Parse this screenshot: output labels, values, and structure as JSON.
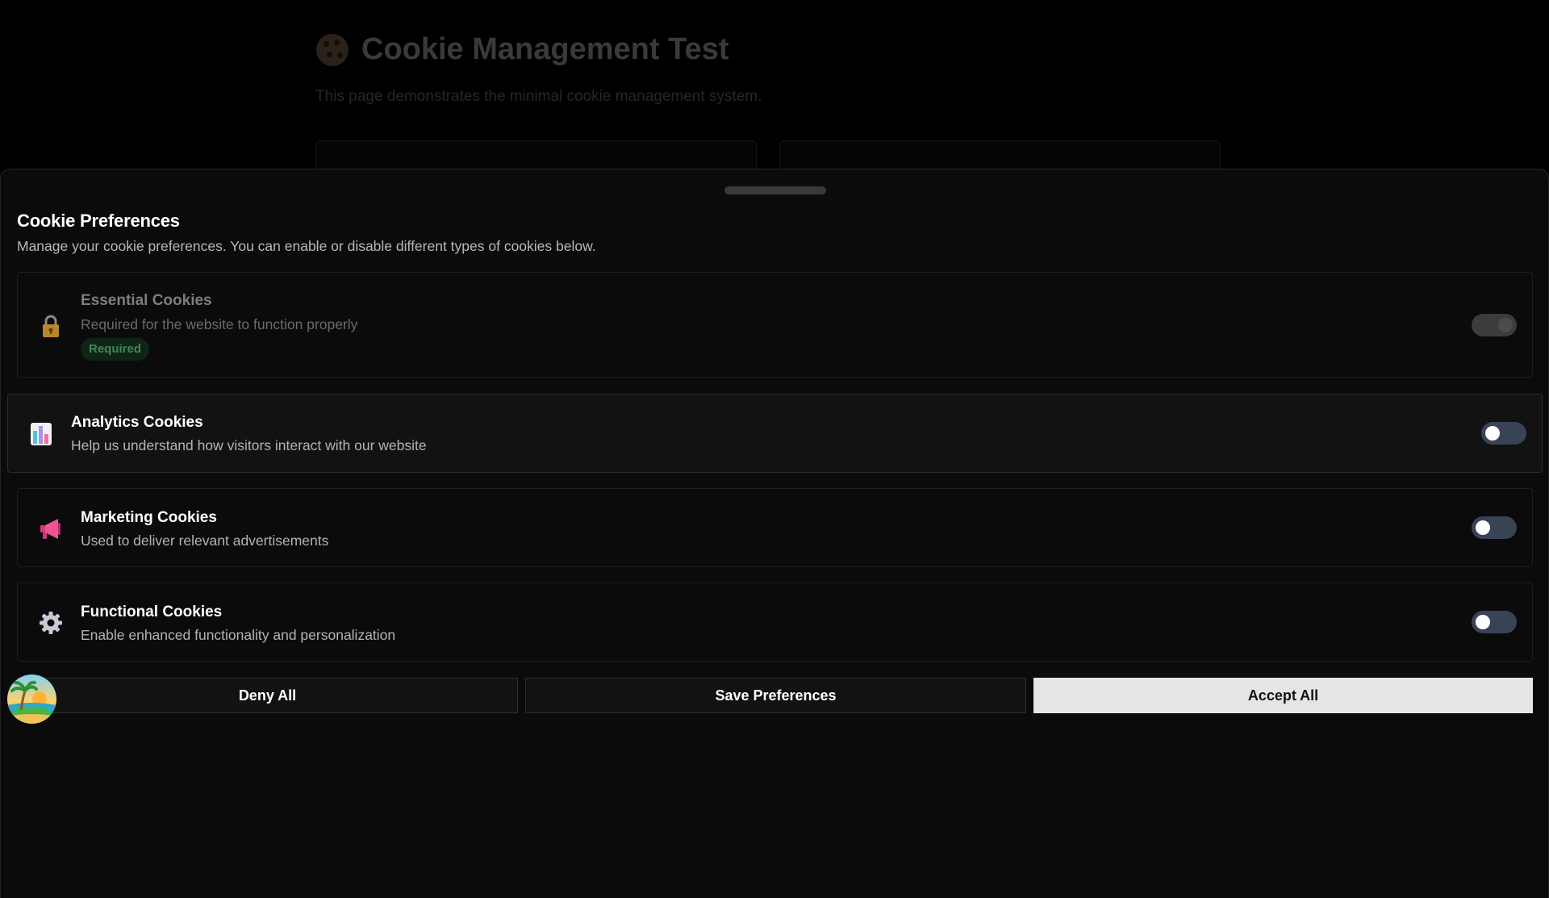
{
  "background_page": {
    "title": "Cookie Management Test",
    "subtitle": "This page demonstrates the minimal cookie management system."
  },
  "sheet": {
    "title": "Cookie Preferences",
    "description": "Manage your cookie preferences. You can enable or disable different types of cookies below."
  },
  "categories": [
    {
      "name": "Essential Cookies",
      "description": "Required for the website to function properly",
      "badge": "Required",
      "icon": "lock-icon",
      "enabled": true,
      "locked": true
    },
    {
      "name": "Analytics Cookies",
      "description": "Help us understand how visitors interact with our website",
      "icon": "bar-chart-icon",
      "enabled": false
    },
    {
      "name": "Marketing Cookies",
      "description": "Used to deliver relevant advertisements",
      "icon": "megaphone-icon",
      "enabled": false
    },
    {
      "name": "Functional Cookies",
      "description": "Enable enhanced functionality and personalization",
      "icon": "gear-icon",
      "enabled": false
    }
  ],
  "actions": {
    "deny_all": "Deny All",
    "save_preferences": "Save Preferences",
    "accept_all": "Accept All"
  },
  "avatar_icon": "beach-avatar-icon",
  "colors": {
    "page_background": "#000000",
    "sheet_background": "#0b0b0b",
    "toggle_off": "#384355",
    "required_badge_bg": "#0f2417",
    "required_badge_text": "#3f8a55",
    "accept_button_bg": "#e5e5e5"
  }
}
